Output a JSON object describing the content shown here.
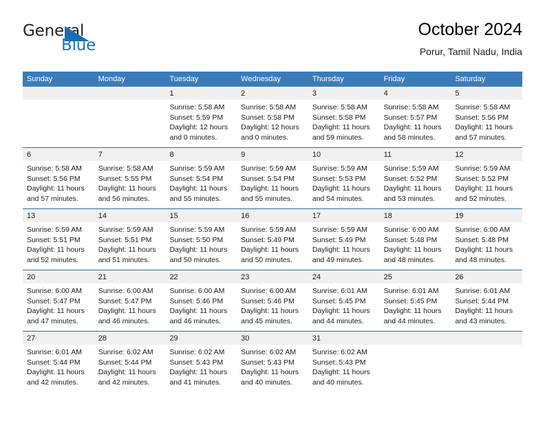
{
  "logo": {
    "word_one": "General",
    "word_two": "Blue",
    "triangle_icon": "triangle-icon",
    "brand_color": "#1b75bb"
  },
  "header": {
    "title": "October 2024",
    "subtitle": "Porur, Tamil Nadu, India"
  },
  "colors": {
    "header_row_bg": "#3a7cba",
    "row_divider": "#2e6da4",
    "day_band_bg": "#f0f0f0"
  },
  "weekdays": [
    "Sunday",
    "Monday",
    "Tuesday",
    "Wednesday",
    "Thursday",
    "Friday",
    "Saturday"
  ],
  "weeks": [
    [
      {
        "day": "",
        "empty": true
      },
      {
        "day": "",
        "empty": true
      },
      {
        "day": "1",
        "sunrise": "Sunrise: 5:58 AM",
        "sunset": "Sunset: 5:59 PM",
        "daylight_1": "Daylight: 12 hours",
        "daylight_2": "and 0 minutes."
      },
      {
        "day": "2",
        "sunrise": "Sunrise: 5:58 AM",
        "sunset": "Sunset: 5:58 PM",
        "daylight_1": "Daylight: 12 hours",
        "daylight_2": "and 0 minutes."
      },
      {
        "day": "3",
        "sunrise": "Sunrise: 5:58 AM",
        "sunset": "Sunset: 5:58 PM",
        "daylight_1": "Daylight: 11 hours",
        "daylight_2": "and 59 minutes."
      },
      {
        "day": "4",
        "sunrise": "Sunrise: 5:58 AM",
        "sunset": "Sunset: 5:57 PM",
        "daylight_1": "Daylight: 11 hours",
        "daylight_2": "and 58 minutes."
      },
      {
        "day": "5",
        "sunrise": "Sunrise: 5:58 AM",
        "sunset": "Sunset: 5:56 PM",
        "daylight_1": "Daylight: 11 hours",
        "daylight_2": "and 57 minutes."
      }
    ],
    [
      {
        "day": "6",
        "sunrise": "Sunrise: 5:58 AM",
        "sunset": "Sunset: 5:56 PM",
        "daylight_1": "Daylight: 11 hours",
        "daylight_2": "and 57 minutes."
      },
      {
        "day": "7",
        "sunrise": "Sunrise: 5:58 AM",
        "sunset": "Sunset: 5:55 PM",
        "daylight_1": "Daylight: 11 hours",
        "daylight_2": "and 56 minutes."
      },
      {
        "day": "8",
        "sunrise": "Sunrise: 5:59 AM",
        "sunset": "Sunset: 5:54 PM",
        "daylight_1": "Daylight: 11 hours",
        "daylight_2": "and 55 minutes."
      },
      {
        "day": "9",
        "sunrise": "Sunrise: 5:59 AM",
        "sunset": "Sunset: 5:54 PM",
        "daylight_1": "Daylight: 11 hours",
        "daylight_2": "and 55 minutes."
      },
      {
        "day": "10",
        "sunrise": "Sunrise: 5:59 AM",
        "sunset": "Sunset: 5:53 PM",
        "daylight_1": "Daylight: 11 hours",
        "daylight_2": "and 54 minutes."
      },
      {
        "day": "11",
        "sunrise": "Sunrise: 5:59 AM",
        "sunset": "Sunset: 5:52 PM",
        "daylight_1": "Daylight: 11 hours",
        "daylight_2": "and 53 minutes."
      },
      {
        "day": "12",
        "sunrise": "Sunrise: 5:59 AM",
        "sunset": "Sunset: 5:52 PM",
        "daylight_1": "Daylight: 11 hours",
        "daylight_2": "and 52 minutes."
      }
    ],
    [
      {
        "day": "13",
        "sunrise": "Sunrise: 5:59 AM",
        "sunset": "Sunset: 5:51 PM",
        "daylight_1": "Daylight: 11 hours",
        "daylight_2": "and 52 minutes."
      },
      {
        "day": "14",
        "sunrise": "Sunrise: 5:59 AM",
        "sunset": "Sunset: 5:51 PM",
        "daylight_1": "Daylight: 11 hours",
        "daylight_2": "and 51 minutes."
      },
      {
        "day": "15",
        "sunrise": "Sunrise: 5:59 AM",
        "sunset": "Sunset: 5:50 PM",
        "daylight_1": "Daylight: 11 hours",
        "daylight_2": "and 50 minutes."
      },
      {
        "day": "16",
        "sunrise": "Sunrise: 5:59 AM",
        "sunset": "Sunset: 5:49 PM",
        "daylight_1": "Daylight: 11 hours",
        "daylight_2": "and 50 minutes."
      },
      {
        "day": "17",
        "sunrise": "Sunrise: 5:59 AM",
        "sunset": "Sunset: 5:49 PM",
        "daylight_1": "Daylight: 11 hours",
        "daylight_2": "and 49 minutes."
      },
      {
        "day": "18",
        "sunrise": "Sunrise: 6:00 AM",
        "sunset": "Sunset: 5:48 PM",
        "daylight_1": "Daylight: 11 hours",
        "daylight_2": "and 48 minutes."
      },
      {
        "day": "19",
        "sunrise": "Sunrise: 6:00 AM",
        "sunset": "Sunset: 5:48 PM",
        "daylight_1": "Daylight: 11 hours",
        "daylight_2": "and 48 minutes."
      }
    ],
    [
      {
        "day": "20",
        "sunrise": "Sunrise: 6:00 AM",
        "sunset": "Sunset: 5:47 PM",
        "daylight_1": "Daylight: 11 hours",
        "daylight_2": "and 47 minutes."
      },
      {
        "day": "21",
        "sunrise": "Sunrise: 6:00 AM",
        "sunset": "Sunset: 5:47 PM",
        "daylight_1": "Daylight: 11 hours",
        "daylight_2": "and 46 minutes."
      },
      {
        "day": "22",
        "sunrise": "Sunrise: 6:00 AM",
        "sunset": "Sunset: 5:46 PM",
        "daylight_1": "Daylight: 11 hours",
        "daylight_2": "and 46 minutes."
      },
      {
        "day": "23",
        "sunrise": "Sunrise: 6:00 AM",
        "sunset": "Sunset: 5:46 PM",
        "daylight_1": "Daylight: 11 hours",
        "daylight_2": "and 45 minutes."
      },
      {
        "day": "24",
        "sunrise": "Sunrise: 6:01 AM",
        "sunset": "Sunset: 5:45 PM",
        "daylight_1": "Daylight: 11 hours",
        "daylight_2": "and 44 minutes."
      },
      {
        "day": "25",
        "sunrise": "Sunrise: 6:01 AM",
        "sunset": "Sunset: 5:45 PM",
        "daylight_1": "Daylight: 11 hours",
        "daylight_2": "and 44 minutes."
      },
      {
        "day": "26",
        "sunrise": "Sunrise: 6:01 AM",
        "sunset": "Sunset: 5:44 PM",
        "daylight_1": "Daylight: 11 hours",
        "daylight_2": "and 43 minutes."
      }
    ],
    [
      {
        "day": "27",
        "sunrise": "Sunrise: 6:01 AM",
        "sunset": "Sunset: 5:44 PM",
        "daylight_1": "Daylight: 11 hours",
        "daylight_2": "and 42 minutes."
      },
      {
        "day": "28",
        "sunrise": "Sunrise: 6:02 AM",
        "sunset": "Sunset: 5:44 PM",
        "daylight_1": "Daylight: 11 hours",
        "daylight_2": "and 42 minutes."
      },
      {
        "day": "29",
        "sunrise": "Sunrise: 6:02 AM",
        "sunset": "Sunset: 5:43 PM",
        "daylight_1": "Daylight: 11 hours",
        "daylight_2": "and 41 minutes."
      },
      {
        "day": "30",
        "sunrise": "Sunrise: 6:02 AM",
        "sunset": "Sunset: 5:43 PM",
        "daylight_1": "Daylight: 11 hours",
        "daylight_2": "and 40 minutes."
      },
      {
        "day": "31",
        "sunrise": "Sunrise: 6:02 AM",
        "sunset": "Sunset: 5:43 PM",
        "daylight_1": "Daylight: 11 hours",
        "daylight_2": "and 40 minutes."
      },
      {
        "day": "",
        "empty": true
      },
      {
        "day": "",
        "empty": true
      }
    ]
  ]
}
